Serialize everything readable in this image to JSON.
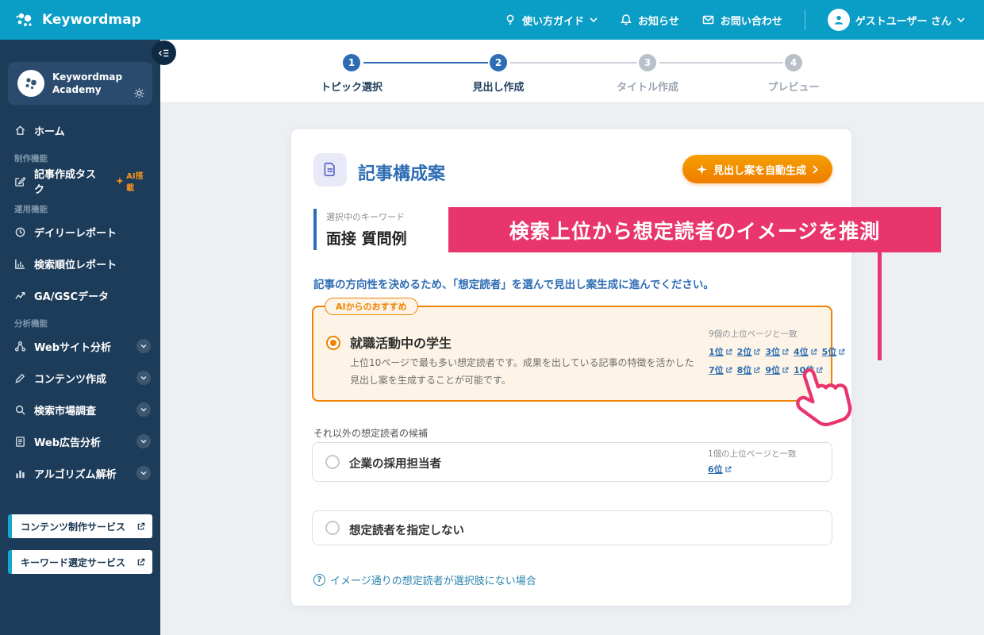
{
  "topbar": {
    "brand": "Keywordmap",
    "guide": "使い方ガイド",
    "news": "お知らせ",
    "contact": "お問い合わせ",
    "user": "ゲストユーザー さん"
  },
  "sidebar": {
    "academy_line1": "Keywordmap",
    "academy_line2": "Academy",
    "home": "ホーム",
    "section_production": "制作機能",
    "article_task": "記事作成タスク",
    "ai_badge": "AI搭載",
    "section_operation": "運用機能",
    "daily_report": "デイリーレポート",
    "rank_report": "検索順位レポート",
    "ga_gsc": "GA/GSCデータ",
    "section_analysis": "分析機能",
    "web_analysis": "Webサイト分析",
    "content_creation": "コンテンツ作成",
    "market_research": "検索市場調査",
    "ad_analysis": "Web広告分析",
    "algorithm": "アルゴリズム解析",
    "content_service": "コンテンツ制作サービス",
    "keyword_service": "キーワード選定サービス"
  },
  "stepper": {
    "steps": [
      {
        "num": "1",
        "label": "トピック選択"
      },
      {
        "num": "2",
        "label": "見出し作成"
      },
      {
        "num": "3",
        "label": "タイトル作成"
      },
      {
        "num": "4",
        "label": "プレビュー"
      }
    ]
  },
  "main": {
    "card_title": "記事構成案",
    "generate_button": "見出し案を自動生成",
    "selected_keyword_label": "選択中のキーワード",
    "selected_keyword": "面接 質問例",
    "instruction": "記事の方向性を決めるため、「想定読者」を選んで見出し案生成に進んでください。",
    "recommend_tag": "AIからのおすすめ",
    "option1": {
      "title": "就職活動中の学生",
      "description": "上位10ページで最も多い想定読者です。成果を出している記事の特徴を活かした見出し案を生成することが可能です。",
      "match_label": "9個の上位ページと一致",
      "links_row1": [
        "1位",
        "2位",
        "3位",
        "4位",
        "5位"
      ],
      "links_row2": [
        "7位",
        "8位",
        "9位",
        "10位"
      ]
    },
    "other_candidates_label": "それ以外の想定読者の候補",
    "option2": {
      "title": "企業の採用担当者",
      "match_label": "1個の上位ページと一致",
      "link": "6位"
    },
    "option3": {
      "title": "想定読者を指定しない"
    },
    "help_link": "イメージ通りの想定読者が選択肢にない場合"
  },
  "annotation": {
    "text": "検索上位から想定読者のイメージを推測"
  },
  "icons": {
    "question": "?"
  },
  "colors": {
    "topbar_cyan": "#0a9dc6",
    "sidebar_navy": "#1d3c59",
    "primary_blue": "#2e6db4",
    "orange": "#ef8200",
    "pink": "#e8356d",
    "link_blue": "#2b6cb0"
  }
}
